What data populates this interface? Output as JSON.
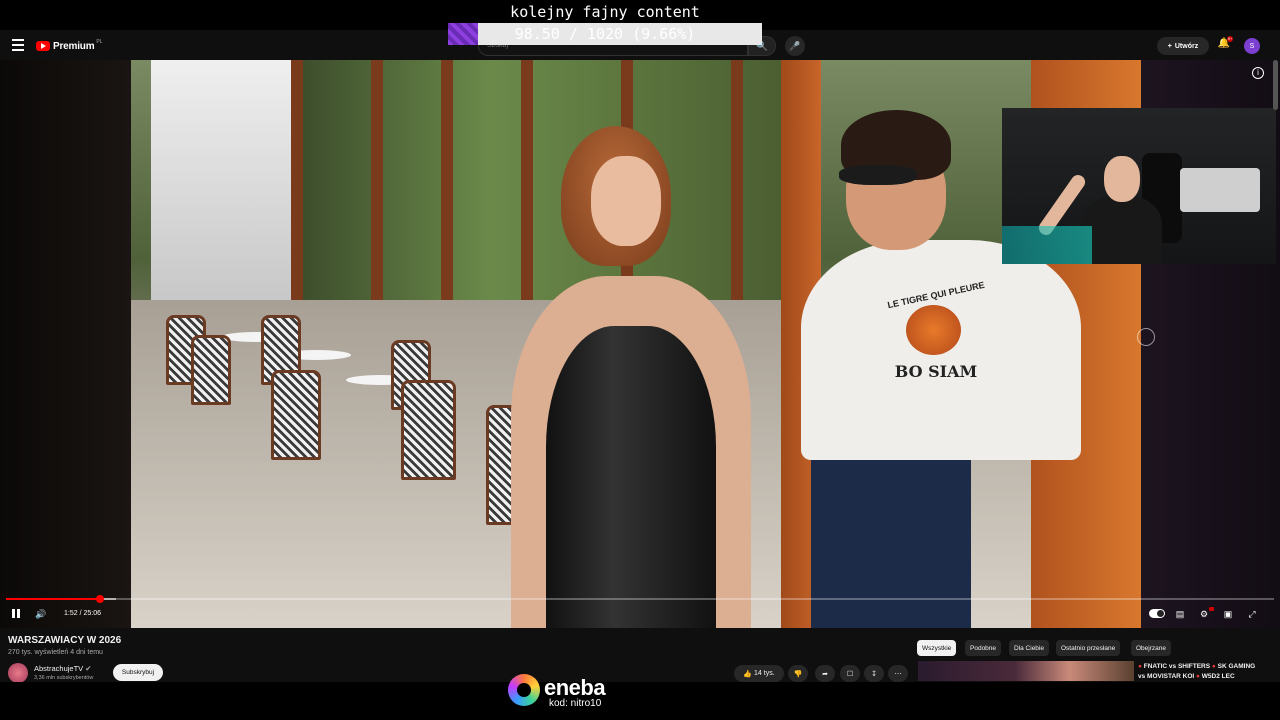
{
  "stream_overlay": {
    "title": "kolejny fajny content",
    "goal_text": "98.50 / 1020 (9.66%)",
    "goal_fraction": 0.0966
  },
  "header": {
    "brand": "Premium",
    "brand_region": "PL",
    "search_placeholder": "Szukaj",
    "create_label": "Utwórz",
    "notifications_badge": "9+",
    "avatar_letter": "S"
  },
  "player": {
    "current_time": "1:52",
    "duration": "25:06",
    "time_display": "1:52 / 25:06",
    "played_fraction": 0.074,
    "buffered_fraction": 0.087
  },
  "video": {
    "title": "WARSZAWIACY W 2026",
    "views_line": "270 tys. wyświetleń  4 dni temu",
    "shirt_text_top": "LE TIGRE QUI PLEURE",
    "shirt_text_bottom": "BO SIAM"
  },
  "channel": {
    "name": "AbstrachujeTV",
    "subscribers": "3,36 mln subskrybentów",
    "subscribe_label": "Subskrybuj"
  },
  "actions": {
    "likes": "14 tys."
  },
  "chips": [
    "Wszystkie",
    "Podobne",
    "Dla Ciebie",
    "Ostatnio przesłane",
    "Obejrzane"
  ],
  "related": {
    "title_line1": "FNATIC vs SHIFTERS",
    "title_line1b": "SK GAMING",
    "title_line2": "vs MOVISTAR KOI",
    "title_line2b": "W5D2 LEC"
  },
  "sponsor": {
    "name": "eneba",
    "code": "kod: nitro10"
  },
  "icons": {
    "menu": "menu-icon",
    "search": "search-icon",
    "mic": "mic-icon",
    "bell": "bell-icon",
    "info": "info-icon"
  },
  "colors": {
    "accent": "#ff0000",
    "goal_fill": "#8e3fe0",
    "background": "#0f0f0f"
  }
}
